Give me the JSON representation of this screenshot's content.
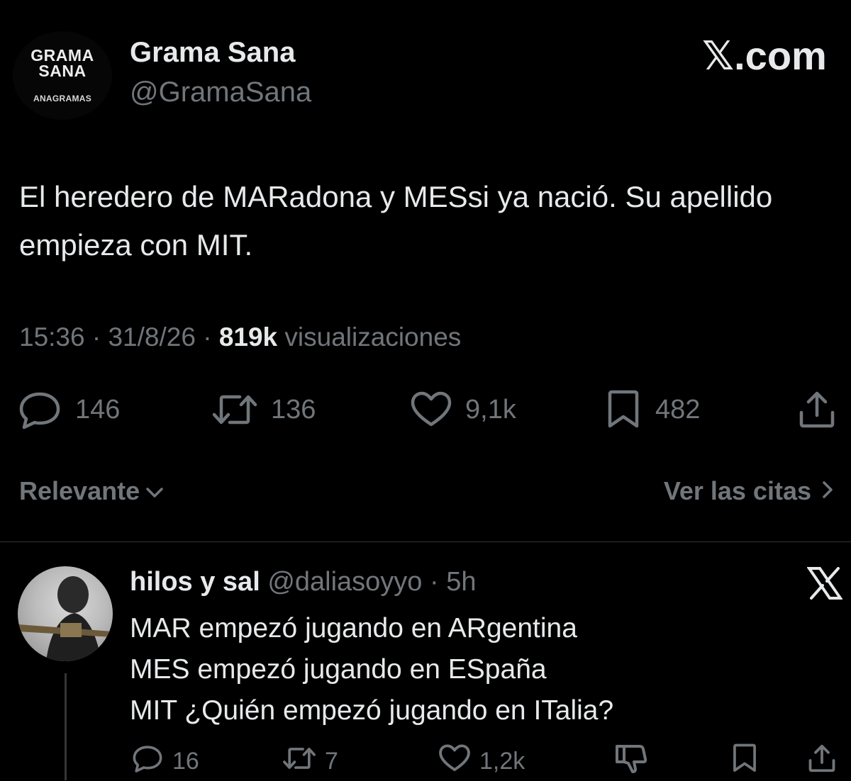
{
  "tweet": {
    "avatar": {
      "line1": "GRAMA",
      "line2": "SANA",
      "line3": "ANAGRAMAS"
    },
    "display_name": "Grama Sana",
    "handle": "@GramaSana",
    "watermark": "𝕏.com",
    "text": "El heredero de MARadona y MESsi ya nació. Su apellido empieza con MIT.",
    "time": "15:36",
    "date": "31/8/26",
    "views_count": "819k",
    "views_label": "visualizaciones",
    "actions": {
      "replies": "146",
      "reposts": "136",
      "likes": "9,1k",
      "bookmarks": "482"
    }
  },
  "sort": {
    "label": "Relevante",
    "quotes_link": "Ver las citas"
  },
  "reply": {
    "name": "hilos y sal",
    "handle": "@daliasoyyo",
    "separator": "·",
    "time": "5h",
    "lines": [
      "MAR empezó jugando en ARgentina",
      "MES empezó jugando en ESpaña",
      "MIT ¿Quién empezó jugando en ITalia?"
    ],
    "actions": {
      "replies": "16",
      "reposts": "7",
      "likes": "1,2k"
    }
  },
  "colors": {
    "background": "#000000",
    "text": "#e7e9ea",
    "muted": "#71767b",
    "divider": "#2f3336"
  },
  "icons": [
    "reply-icon",
    "repost-icon",
    "like-icon",
    "bookmark-icon",
    "share-icon",
    "chevron-down-icon",
    "chevron-right-icon",
    "x-logo-icon",
    "dislike-icon"
  ]
}
